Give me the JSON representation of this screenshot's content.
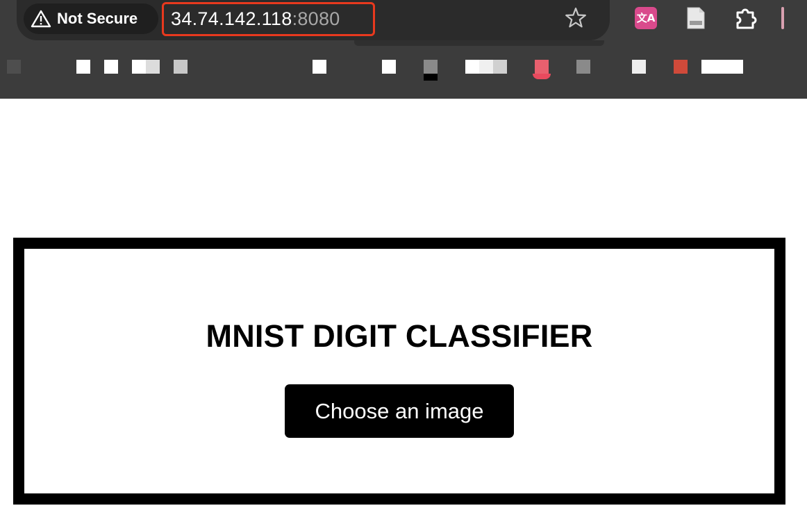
{
  "browser": {
    "security_label": "Not Secure",
    "url_host": "34.74.142.118",
    "url_port": ":8080",
    "translate_glyph": "文A",
    "icons": [
      "warning-icon",
      "star-icon",
      "translate-icon",
      "document-icon",
      "extension-icon"
    ],
    "highlight_color": "#e8391e"
  },
  "page": {
    "title": "MNIST DIGIT CLASSIFIER",
    "choose_button_label": "Choose an image"
  }
}
